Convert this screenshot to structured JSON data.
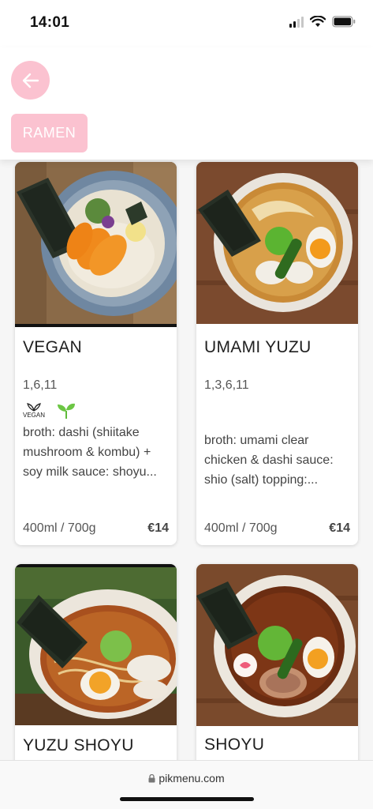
{
  "status": {
    "time": "14:01"
  },
  "header": {
    "category": "RAMEN"
  },
  "items": [
    {
      "title": "VEGAN",
      "allergens": "1,6,11",
      "badge_vegan": "VEGAN",
      "description": "broth: dashi (shiitake mushroom & kombu) + soy milk sauce: shoyu...",
      "size": "400ml / 700g",
      "price": "€14"
    },
    {
      "title": "UMAMI YUZU",
      "allergens": "1,3,6,11",
      "description": "broth: umami clear chicken & dashi sauce: shio (salt) topping:...",
      "size": "400ml / 700g",
      "price": "€14"
    },
    {
      "title": "YUZU SHOYU"
    },
    {
      "title": "SHOYU"
    }
  ],
  "browser": {
    "url": "pikmenu.com"
  },
  "colors": {
    "accent": "#fbc2d0",
    "background": "#f6f6f6"
  }
}
